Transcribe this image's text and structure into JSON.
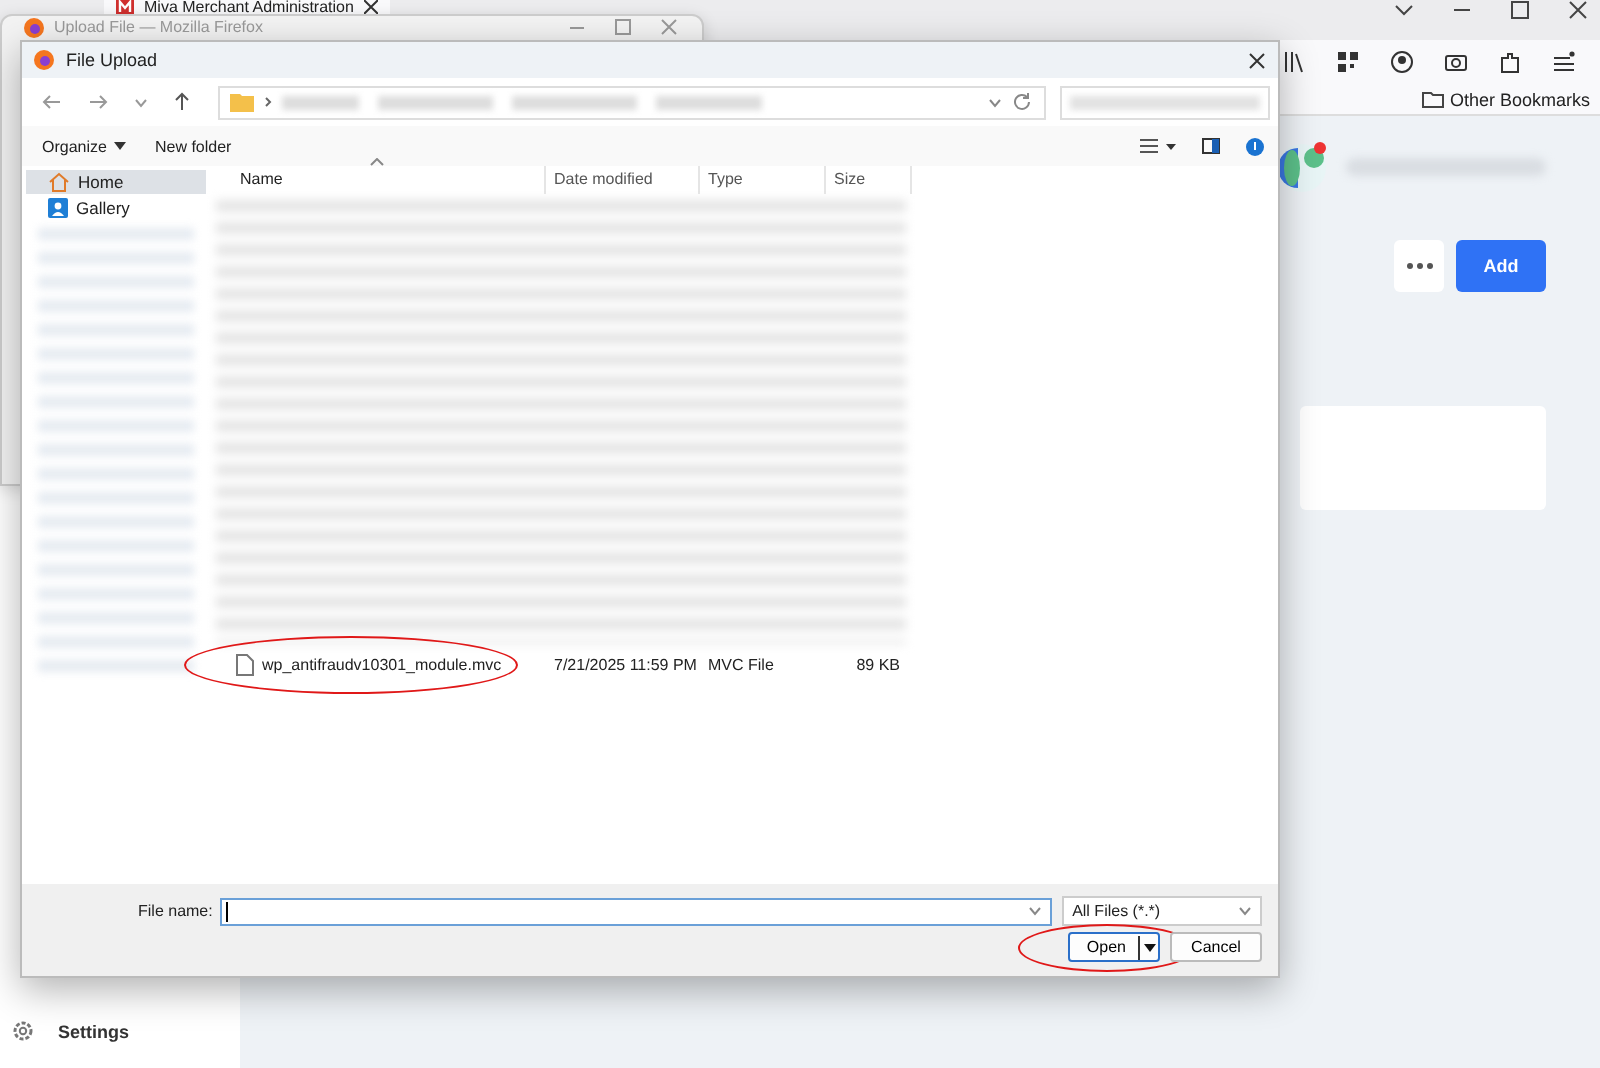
{
  "browser": {
    "tab_title": "Miva Merchant Administration",
    "bookmark": "Other Bookmarks",
    "page_buttons": [
      {
        "kind": "more"
      },
      {
        "kind": "primary",
        "label": "Add"
      }
    ],
    "sidebar_footer": "Settings"
  },
  "background_window": {
    "title": "Upload File — Mozilla Firefox"
  },
  "dialog": {
    "title": "File Upload",
    "toolbar": [
      {
        "kind": "menu",
        "label": "Organize"
      },
      {
        "kind": "plain",
        "label": "New folder"
      }
    ],
    "nav": [
      {
        "kind": "home",
        "label": "Home",
        "selected": true
      },
      {
        "kind": "gallery",
        "label": "Gallery",
        "selected": false
      }
    ],
    "columns": [
      {
        "label": "Name",
        "sorted": true
      },
      {
        "label": "Date modified",
        "sorted": false
      },
      {
        "label": "Type",
        "sorted": false
      },
      {
        "label": "Size",
        "sorted": false
      }
    ],
    "files": [
      {
        "name": "wp_antifraudv10301_module.mvc",
        "date": "7/21/2025 11:59 PM",
        "type": "MVC File",
        "size": "89 KB",
        "highlighted": true
      }
    ],
    "file_name_label": "File name:",
    "filter": "All Files (*.*)",
    "buttons": [
      {
        "kind": "split",
        "label": "Open",
        "highlighted": true
      },
      {
        "kind": "plain",
        "label": "Cancel",
        "highlighted": false
      }
    ]
  }
}
